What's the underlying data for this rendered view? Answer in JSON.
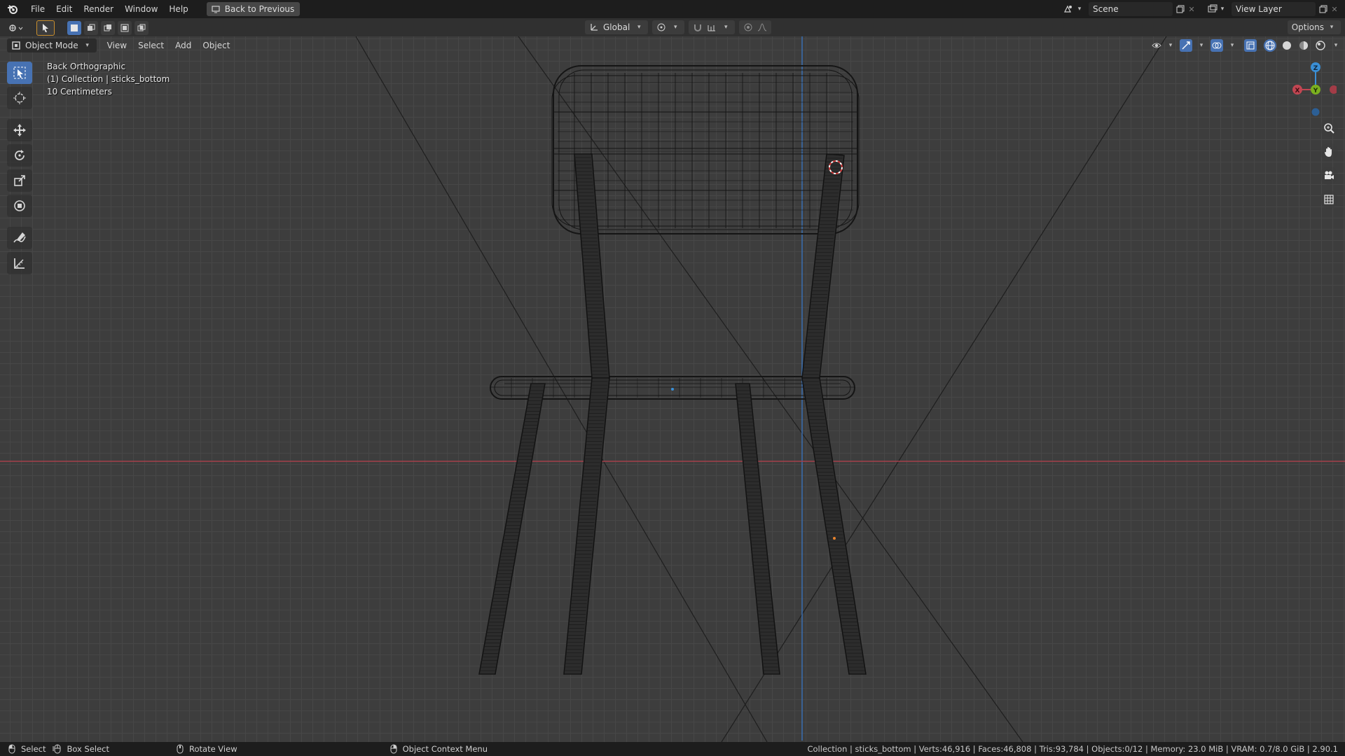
{
  "topbar": {
    "menus": [
      "File",
      "Edit",
      "Render",
      "Window",
      "Help"
    ],
    "back_button": "Back to Previous",
    "scene": "Scene",
    "view_layer": "View Layer"
  },
  "toolrow": {
    "transform_orientation": "Global",
    "options": "Options"
  },
  "viewport_header": {
    "mode": "Object Mode",
    "menus": [
      "View",
      "Select",
      "Add",
      "Object"
    ]
  },
  "overlay": {
    "view_name": "Back Orthographic",
    "collection_info": "(1) Collection | sticks_bottom",
    "scale_info": "10 Centimeters"
  },
  "gizmo": {
    "z_label": "Z",
    "y_label": "Y",
    "x_label": "X"
  },
  "statusbar": {
    "select": "Select",
    "box_select": "Box Select",
    "rotate_view": "Rotate View",
    "context_menu": "Object Context Menu",
    "stats": "Collection | sticks_bottom | Verts:46,916 | Faces:46,808 | Tris:93,784 | Objects:0/12 | Memory: 23.0 MiB | VRAM: 0.7/8.0 GiB | 2.90.1"
  },
  "colors": {
    "accent": "#4772b3",
    "x_axis": "#c24652",
    "y_axis": "#7bb01f",
    "z_axis": "#3a8fd6",
    "wire": "#141414"
  }
}
